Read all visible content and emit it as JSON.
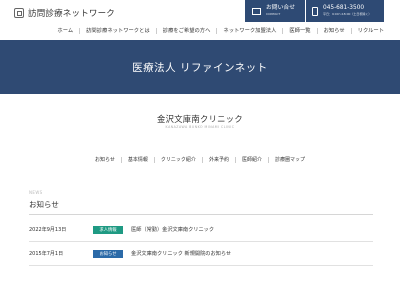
{
  "header": {
    "logo_text": "訪問診療ネットワーク",
    "contact": {
      "label": "お問い合せ",
      "sub": "CONTACT"
    },
    "phone": {
      "number": "045-681-3500",
      "hours": "平日：9:00～18:00（土日祝除く）"
    }
  },
  "nav": {
    "items": [
      "ホーム",
      "訪問診療ネットワークとは",
      "診療をご希望の方へ",
      "ネットワーク加盟法人",
      "医師一覧",
      "お知らせ",
      "リクルート"
    ]
  },
  "hero": {
    "title": "医療法人 リファインネット"
  },
  "clinic": {
    "name": "金沢文庫南クリニック",
    "name_en": "KANAZAWA BUNKO MINAMI CLINIC"
  },
  "subnav": {
    "items": [
      "お知らせ",
      "基本情報",
      "クリニック紹介",
      "外来予約",
      "医師紹介",
      "診療圏マップ"
    ]
  },
  "news": {
    "label": "NEWS",
    "heading": "お知らせ",
    "items": [
      {
        "date": "2022年9月13日",
        "badge": "求人情報",
        "badge_color": "#1f9a83",
        "title": "医師（常勤）金沢文庫南クリニック"
      },
      {
        "date": "2015年7月1日",
        "badge": "お知らせ",
        "badge_color": "#2b6aa8",
        "title": "金沢文庫南クリニック 新規開院のお知らせ"
      }
    ]
  },
  "colors": {
    "primary": "#2e4a74",
    "badge_recruit": "#1f9a83",
    "badge_news": "#2b6aa8"
  }
}
